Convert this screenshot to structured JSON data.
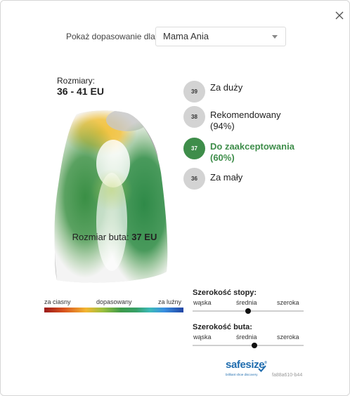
{
  "profile": {
    "label": "Pokaż dopasowanie dla",
    "selected": "Mama Ania"
  },
  "sizes": {
    "title": "Rozmiary:",
    "range": "36 - 41 EU"
  },
  "size_list": [
    {
      "size": "39",
      "label": "Za duży",
      "label2": "",
      "active": false
    },
    {
      "size": "38",
      "label": "Rekomendowany",
      "label2": "(94%)",
      "active": false
    },
    {
      "size": "37",
      "label": "Do zaakceptowania",
      "label2": "(60%)",
      "active": true
    },
    {
      "size": "36",
      "label": "Za mały",
      "label2": "",
      "active": false
    }
  ],
  "shoe_size": {
    "label": "Rozmiar buta:",
    "value": "37 EU"
  },
  "fit_scale": {
    "tight": "za ciasny",
    "fitted": "dopasowany",
    "loose": "za luźny"
  },
  "foot_width": {
    "title": "Szerokość stopy:",
    "narrow": "wąska",
    "medium": "średnia",
    "wide": "szeroka",
    "level": 0.5
  },
  "shoe_width": {
    "title": "Szerokość buta:",
    "narrow": "wąska",
    "medium": "średnia",
    "wide": "szeroka",
    "level": 0.56
  },
  "brand": {
    "name": "safesize",
    "registered": "®",
    "tagline": "brilliant shoe discovery"
  },
  "session_id": "fa88a610-b44",
  "colors": {
    "accent_green": "#3e8d4a",
    "brand_blue": "#1f6cae",
    "inactive_circle": "#d3d3d3"
  }
}
